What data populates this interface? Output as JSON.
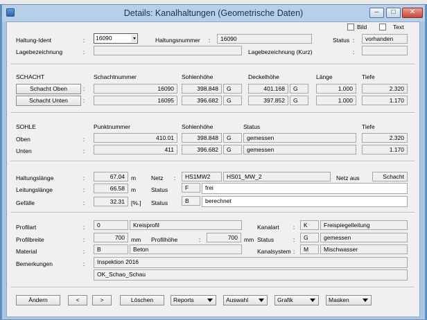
{
  "window": {
    "title": "Details: Kanalhaltungen (Geometrische Daten)"
  },
  "options": {
    "bild": "Bild",
    "text": "Text"
  },
  "header": {
    "haltung_ident_label": "Haltung-Ident",
    "haltung_ident_value": "16090",
    "haltungsnummer_label": "Haltungsnummer",
    "haltungsnummer_value": "16090",
    "status_label": "Status",
    "status_value": "vorhanden",
    "lagebezeichnung_label": "Lagebezeichnung",
    "lagebezeichnung_kurz_label": "Lagebezeichnung (Kurz)"
  },
  "schacht": {
    "section_label": "SCHACHT",
    "col_schachtnummer": "Schachtnummer",
    "col_sohlenhoehe": "Sohlenhöhe",
    "col_deckelhoehe": "Deckelhöhe",
    "col_laenge": "Länge",
    "col_tiefe": "Tiefe",
    "rows": [
      {
        "button": "Schacht  Oben",
        "nummer": "16090",
        "sohle": "398.848",
        "sohle_g": "G",
        "deckel": "401.168",
        "deckel_g": "G",
        "laenge": "1.000",
        "tiefe": "2.320"
      },
      {
        "button": "Schacht Unten",
        "nummer": "16095",
        "sohle": "396.682",
        "sohle_g": "G",
        "deckel": "397.852",
        "deckel_g": "G",
        "laenge": "1.000",
        "tiefe": "1.170"
      }
    ]
  },
  "sohle": {
    "section_label": "SOHLE",
    "col_punktnummer": "Punktnummer",
    "col_sohlenhoehe": "Sohlenhöhe",
    "col_status": "Status",
    "col_tiefe": "Tiefe",
    "rows": [
      {
        "label": "Oben",
        "punkt": "410.01",
        "sohle": "398.848",
        "sohle_g": "G",
        "status": "gemessen",
        "tiefe": "2.320"
      },
      {
        "label": "Unten",
        "punkt": "411",
        "sohle": "396.682",
        "sohle_g": "G",
        "status": "gemessen",
        "tiefe": "1.170"
      }
    ]
  },
  "lengths": {
    "haltungslaenge_label": "Haltungslänge",
    "haltungslaenge_value": "67.04",
    "haltungslaenge_unit": "m",
    "netz_label": "Netz",
    "netz_code": "HS1MW2",
    "netz_name": "HS01_MW_2",
    "netz_aus_label": "Netz aus",
    "netz_aus_value": "Schacht",
    "leitungslaenge_label": "Leitungslänge",
    "leitungslaenge_value": "66.58",
    "leitungslaenge_unit": "m",
    "status1_label": "Status",
    "status1_code": "F",
    "status1_text": "frei",
    "gefaelle_label": "Gefälle",
    "gefaelle_value": "32.31",
    "gefaelle_unit": "[%.]",
    "status2_label": "Status",
    "status2_code": "B",
    "status2_text": "berechnet"
  },
  "profile": {
    "profilart_label": "Profilart",
    "profilart_code": "0",
    "profilart_text": "Kreisprofil",
    "kanalart_label": "Kanalart",
    "kanalart_code": "K",
    "kanalart_text": "Freispiegelleitung",
    "profilbreite_label": "Profilbreite",
    "profilbreite_value": "700",
    "profilbreite_unit": "mm",
    "profilhoehe_label": "Profilhöhe",
    "profilhoehe_value": "700",
    "profilhoehe_unit": "mm",
    "status_label": "Status",
    "status_code": "G",
    "status_text": "gemessen",
    "material_label": "Material",
    "material_code": "B",
    "material_text": "Beton",
    "kanalsystem_label": "Kanalsystem",
    "kanalsystem_code": "M",
    "kanalsystem_text": "Mischwasser",
    "bemerkungen_label": "Bemerkungen",
    "bemerkung_1": "Inspektion 2016",
    "bemerkung_2": "OK_Schao_Schau"
  },
  "footer": {
    "aendern": "Ändern",
    "prev": "<",
    "next": ">",
    "loeschen": "Löschen",
    "reports": "Reports",
    "auswahl": "Auswahl",
    "grafik": "Grafik",
    "masken": "Masken"
  },
  "colors": {
    "window_frame": "#a9c6e6",
    "client_bg": "#f0f0f0",
    "close_button": "#c4483a"
  }
}
